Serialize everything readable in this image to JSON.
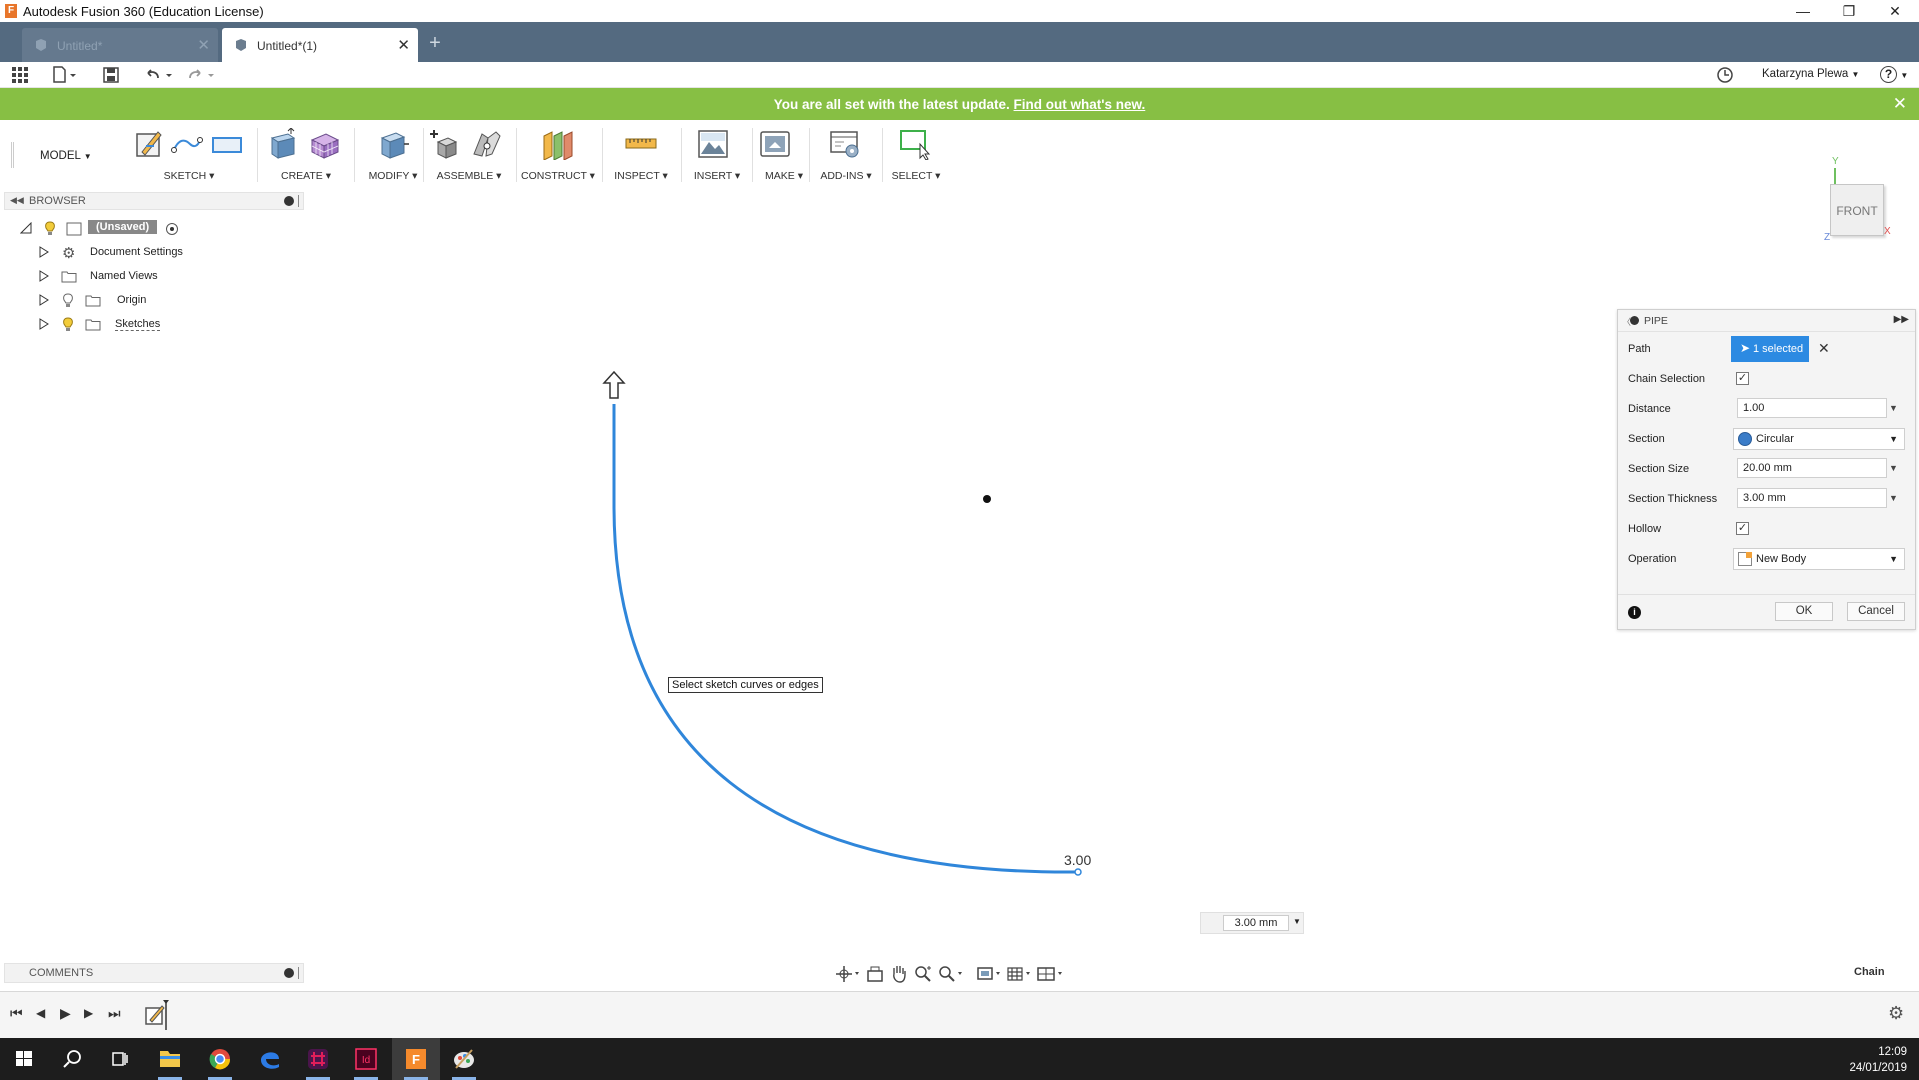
{
  "window": {
    "title": "Autodesk Fusion 360 (Education License)",
    "minimize_label": "—",
    "maximize_label": "❐",
    "close_label": "✕"
  },
  "tabs": [
    {
      "label": "Untitled*",
      "active": false
    },
    {
      "label": "Untitled*(1)",
      "active": true
    }
  ],
  "tab_close_glyph": "✕",
  "new_tab_glyph": "+",
  "quick_access": {
    "user_name": "Katarzyna Plewa",
    "help_glyph": "?"
  },
  "banner": {
    "message": "You are all set with the latest update.",
    "link_text": "Find out what's new.",
    "close_glyph": "✕"
  },
  "toolbar": {
    "workspace": "MODEL",
    "groups": [
      "SKETCH",
      "CREATE",
      "MODIFY",
      "ASSEMBLE",
      "CONSTRUCT",
      "INSPECT",
      "INSERT",
      "MAKE",
      "ADD-INS",
      "SELECT"
    ]
  },
  "browser": {
    "title": "BROWSER",
    "root_label": "(Unsaved)",
    "items": [
      {
        "label": "Document Settings"
      },
      {
        "label": "Named Views"
      },
      {
        "label": "Origin"
      },
      {
        "label": "Sketches"
      }
    ]
  },
  "viewcube": {
    "face": "FRONT",
    "axis_y": "Y",
    "axis_x": "X",
    "axis_z": "Z"
  },
  "viewport": {
    "tooltip": "Select sketch curves or edges",
    "dimension_label": "3.00",
    "thickness_input": "3.00 mm",
    "status_right": "Chain"
  },
  "pipe_dialog": {
    "title": "PIPE",
    "rows": {
      "path_label": "Path",
      "path_value": "1 selected",
      "chain_label": "Chain Selection",
      "chain_checked": true,
      "distance_label": "Distance",
      "distance_value": "1.00",
      "section_label": "Section",
      "section_value": "Circular",
      "size_label": "Section Size",
      "size_value": "20.00 mm",
      "thickness_label": "Section Thickness",
      "thickness_value": "3.00 mm",
      "hollow_label": "Hollow",
      "hollow_checked": true,
      "operation_label": "Operation",
      "operation_value": "New Body"
    },
    "ok_label": "OK",
    "cancel_label": "Cancel",
    "check_glyph": "✓"
  },
  "comments": {
    "title": "COMMENTS"
  },
  "taskbar": {
    "time": "12:09",
    "date": "24/01/2019"
  },
  "colors": {
    "accent_blue": "#2c8ae2",
    "banner_green": "#87bf44",
    "tab_strip": "#546a80",
    "curve_blue": "#2f86da"
  }
}
